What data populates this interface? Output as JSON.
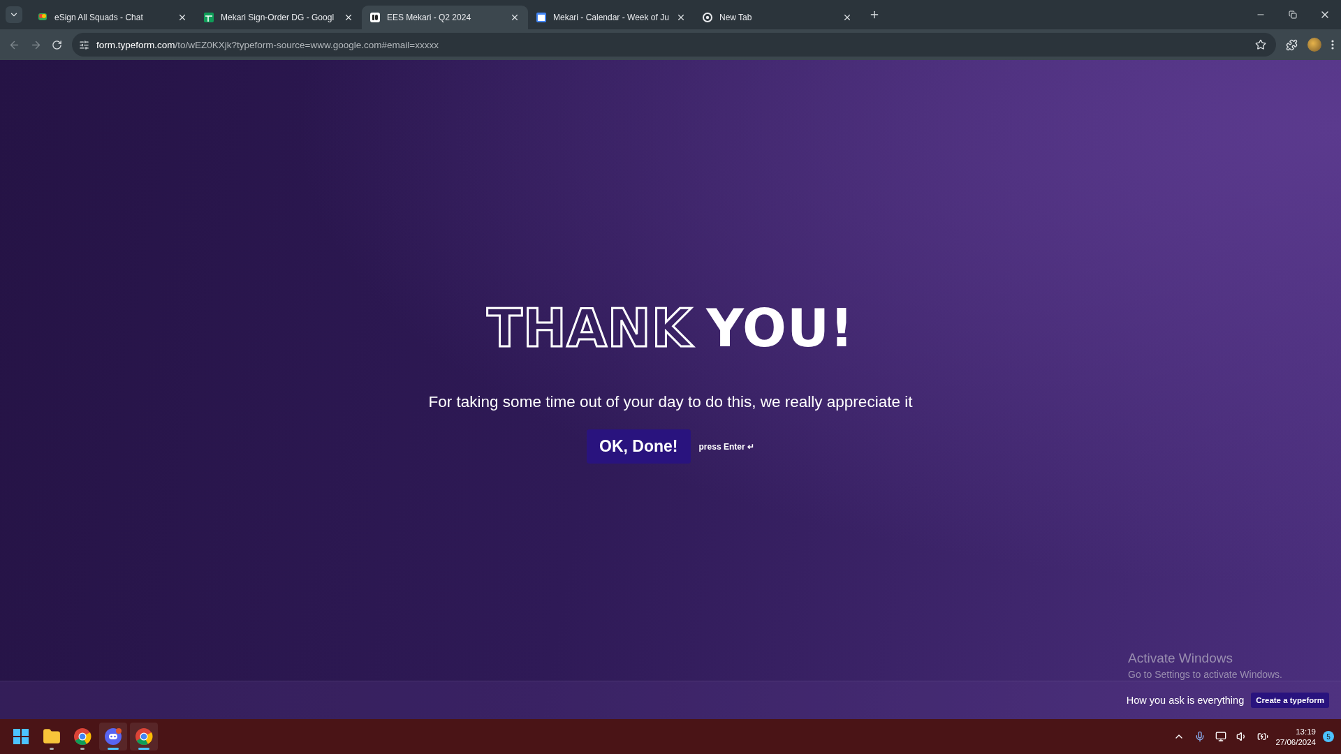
{
  "tabs": [
    {
      "title": "eSign All Squads - Chat",
      "kind": "chat",
      "selected": false
    },
    {
      "title": "Mekari Sign-Order DG - Googl",
      "kind": "sheet",
      "selected": false
    },
    {
      "title": "EES Mekari - Q2 2024",
      "kind": "form",
      "selected": true
    },
    {
      "title": "Mekari - Calendar - Week of Ju",
      "kind": "calendar",
      "selected": false
    },
    {
      "title": "New Tab",
      "kind": "browser",
      "selected": false
    }
  ],
  "address_bar": {
    "host": "form.typeform.com",
    "path": "/to/wEZ0KXjk?typeform-source=www.google.com#email=xxxxx"
  },
  "page": {
    "heading_outline": "THANK",
    "heading_solid": "YOU!",
    "message": "For taking some time out of your day to do this, we really appreciate it",
    "button": "OK, Done!",
    "hint": "press Enter ↵"
  },
  "activation": {
    "title": "Activate Windows",
    "subtitle": "Go to Settings to activate Windows."
  },
  "footer": {
    "tagline": "How you ask is everything",
    "button": "Create a typeform"
  },
  "taskbar": {
    "apps": [
      {
        "kind": "start",
        "active": false
      },
      {
        "kind": "folder",
        "active": false
      },
      {
        "kind": "chrome",
        "active": false
      },
      {
        "kind": "discord",
        "active": true
      },
      {
        "kind": "chrome",
        "active": true
      }
    ],
    "time": "13:19",
    "date": "27/06/2024",
    "notifications": "5"
  }
}
